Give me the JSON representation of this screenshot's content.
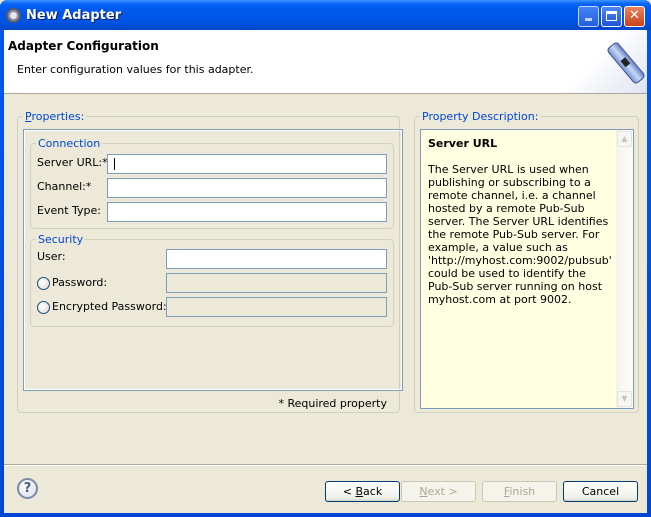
{
  "window": {
    "title": "New Adapter",
    "controls": {
      "minimize": "minimize",
      "maximize": "maximize",
      "close": "close"
    }
  },
  "banner": {
    "title": "Adapter Configuration",
    "description": "Enter configuration values for this adapter.",
    "icon": "usb-adapter-icon"
  },
  "properties": {
    "legend_underlined": "P",
    "legend_rest": "roperties:",
    "connection": {
      "legend": "Connection",
      "fields": [
        {
          "label": "Server URL:*",
          "value": "",
          "required": true,
          "focused": true
        },
        {
          "label": "Channel:*",
          "value": "",
          "required": true
        },
        {
          "label": "Event Type:",
          "value": "",
          "required": false
        }
      ]
    },
    "security": {
      "legend": "Security",
      "user_label": "User:",
      "user_value": "",
      "password_label": "Password:",
      "password_value": "",
      "encrypted_password_label": "Encrypted Password:",
      "encrypted_password_value": ""
    },
    "required_note": "* Required property"
  },
  "description": {
    "legend": "Property Description:",
    "title": "Server URL",
    "text": "The Server URL is used when publishing or subscribing to a remote channel, i.e. a channel hosted by a remote Pub-Sub server.  The Server URL identifies the remote Pub-Sub server. For example, a value such as 'http://myhost.com:9002/pubsub' could be used to identify the Pub-Sub server running on host myhost.com at port 9002."
  },
  "footer": {
    "help": "?",
    "back": {
      "prefix": "< ",
      "mnemonic": "B",
      "rest": "ack"
    },
    "next": {
      "mnemonic": "N",
      "rest": "ext >"
    },
    "finish": {
      "mnemonic": "F",
      "rest": "inish"
    },
    "cancel": "Cancel"
  },
  "colors": {
    "titlebar": "#0058ee",
    "legend": "#0046d5",
    "dialog_bg": "#ece9d8",
    "description_bg": "#ffffe1"
  }
}
